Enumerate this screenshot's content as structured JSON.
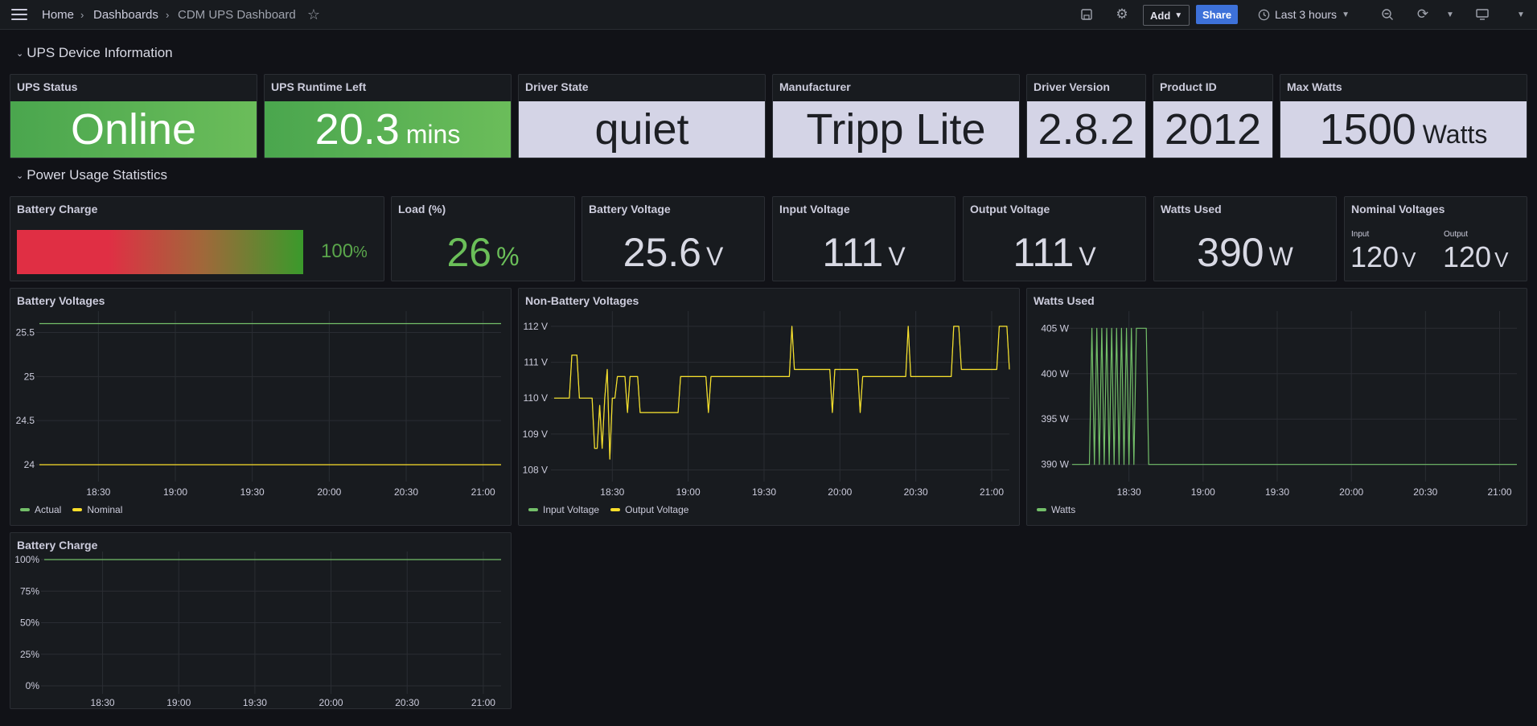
{
  "breadcrumb": {
    "home": "Home",
    "dashboards": "Dashboards",
    "current": "CDM UPS Dashboard"
  },
  "toolbar": {
    "add_label": "Add",
    "share_label": "Share",
    "time_range": "Last 3 hours"
  },
  "rows": {
    "device_info": "UPS Device Information",
    "power_usage": "Power Usage Statistics"
  },
  "device_stats": {
    "ups_status": {
      "title": "UPS Status",
      "value": "Online"
    },
    "runtime": {
      "title": "UPS Runtime Left",
      "value": "20.3",
      "unit": "mins"
    },
    "driver_state": {
      "title": "Driver State",
      "value": "quiet"
    },
    "manufacturer": {
      "title": "Manufacturer",
      "value": "Tripp Lite"
    },
    "driver_version": {
      "title": "Driver Version",
      "value": "2.8.2"
    },
    "product_id": {
      "title": "Product ID",
      "value": "2012"
    },
    "max_watts": {
      "title": "Max Watts",
      "value": "1500",
      "unit": "Watts"
    }
  },
  "power_stats": {
    "battery_charge": {
      "title": "Battery Charge",
      "value": "100",
      "unit": "%",
      "fraction": 1.0
    },
    "load": {
      "title": "Load (%)",
      "value": "26",
      "unit": "%"
    },
    "battery_voltage": {
      "title": "Battery Voltage",
      "value": "25.6",
      "unit": "V"
    },
    "input_voltage": {
      "title": "Input Voltage",
      "value": "111",
      "unit": "V"
    },
    "output_voltage": {
      "title": "Output Voltage",
      "value": "111",
      "unit": "V"
    },
    "watts_used": {
      "title": "Watts Used",
      "value": "390",
      "unit": "W"
    },
    "nominal_voltages": {
      "title": "Nominal Voltages",
      "input_label": "Input",
      "input_value": "120",
      "input_unit": "V",
      "output_label": "Output",
      "output_value": "120",
      "output_unit": "V"
    }
  },
  "colors": {
    "green": "#73bf69",
    "yellow": "#fade2a",
    "accent_blue": "#3d71d9",
    "red": "#e02f44"
  },
  "chart_data": [
    {
      "type": "line",
      "title": "Battery Voltages",
      "x_ticks": [
        "18:30",
        "19:00",
        "19:30",
        "20:00",
        "20:30",
        "21:00"
      ],
      "y_ticks": [
        "25.5",
        "25",
        "24.5",
        "24"
      ],
      "ylim": [
        23.9,
        25.65
      ],
      "series": [
        {
          "name": "Actual",
          "color": "#73bf69",
          "points": [
            [
              "18:07",
              25.6
            ],
            [
              "21:07",
              25.6
            ]
          ]
        },
        {
          "name": "Nominal",
          "color": "#fade2a",
          "points": [
            [
              "18:07",
              24
            ],
            [
              "21:07",
              24
            ]
          ]
        }
      ]
    },
    {
      "type": "line",
      "title": "Non-Battery Voltages",
      "x_ticks": [
        "18:30",
        "19:00",
        "19:30",
        "20:00",
        "20:30",
        "21:00"
      ],
      "y_ticks": [
        "112 V",
        "111 V",
        "110 V",
        "109 V",
        "108 V"
      ],
      "ylim": [
        107.9,
        112.2
      ],
      "series": [
        {
          "name": "Input Voltage",
          "color": "#73bf69",
          "points": [
            [
              "18:07",
              110
            ],
            [
              "18:13",
              110
            ],
            [
              "18:14",
              111.2
            ],
            [
              "18:16",
              111.2
            ],
            [
              "18:17",
              110
            ],
            [
              "18:22",
              110
            ],
            [
              "18:23",
              108.6
            ],
            [
              "18:24",
              108.6
            ],
            [
              "18:25",
              109.8
            ],
            [
              "18:26",
              108.6
            ],
            [
              "18:27",
              110
            ],
            [
              "18:28",
              110.8
            ],
            [
              "18:29",
              108.3
            ],
            [
              "18:30",
              110
            ],
            [
              "18:31",
              110
            ],
            [
              "18:32",
              110.6
            ],
            [
              "18:35",
              110.6
            ],
            [
              "18:36",
              109.6
            ],
            [
              "18:37",
              110.6
            ],
            [
              "18:40",
              110.6
            ],
            [
              "18:41",
              109.6
            ],
            [
              "18:56",
              109.6
            ],
            [
              "18:57",
              110.6
            ],
            [
              "19:07",
              110.6
            ],
            [
              "19:08",
              109.6
            ],
            [
              "19:09",
              110.6
            ],
            [
              "19:40",
              110.6
            ],
            [
              "19:41",
              112
            ],
            [
              "19:42",
              110.8
            ],
            [
              "19:56",
              110.8
            ],
            [
              "19:57",
              109.6
            ],
            [
              "19:58",
              110.8
            ],
            [
              "20:07",
              110.8
            ],
            [
              "20:08",
              109.6
            ],
            [
              "20:09",
              110.6
            ],
            [
              "20:26",
              110.6
            ],
            [
              "20:27",
              112
            ],
            [
              "20:28",
              110.6
            ],
            [
              "20:44",
              110.6
            ],
            [
              "20:45",
              112
            ],
            [
              "20:47",
              112
            ],
            [
              "20:48",
              110.8
            ],
            [
              "21:02",
              110.8
            ],
            [
              "21:03",
              112
            ],
            [
              "21:06",
              112
            ],
            [
              "21:07",
              110.8
            ]
          ]
        },
        {
          "name": "Output Voltage",
          "color": "#fade2a",
          "points": [
            [
              "18:07",
              110
            ],
            [
              "18:13",
              110
            ],
            [
              "18:14",
              111.2
            ],
            [
              "18:16",
              111.2
            ],
            [
              "18:17",
              110
            ],
            [
              "18:22",
              110
            ],
            [
              "18:23",
              108.6
            ],
            [
              "18:24",
              108.6
            ],
            [
              "18:25",
              109.8
            ],
            [
              "18:26",
              108.6
            ],
            [
              "18:27",
              110
            ],
            [
              "18:28",
              110.8
            ],
            [
              "18:29",
              108.3
            ],
            [
              "18:30",
              110
            ],
            [
              "18:31",
              110
            ],
            [
              "18:32",
              110.6
            ],
            [
              "18:35",
              110.6
            ],
            [
              "18:36",
              109.6
            ],
            [
              "18:37",
              110.6
            ],
            [
              "18:40",
              110.6
            ],
            [
              "18:41",
              109.6
            ],
            [
              "18:56",
              109.6
            ],
            [
              "18:57",
              110.6
            ],
            [
              "19:07",
              110.6
            ],
            [
              "19:08",
              109.6
            ],
            [
              "19:09",
              110.6
            ],
            [
              "19:40",
              110.6
            ],
            [
              "19:41",
              112
            ],
            [
              "19:42",
              110.8
            ],
            [
              "19:56",
              110.8
            ],
            [
              "19:57",
              109.6
            ],
            [
              "19:58",
              110.8
            ],
            [
              "20:07",
              110.8
            ],
            [
              "20:08",
              109.6
            ],
            [
              "20:09",
              110.6
            ],
            [
              "20:26",
              110.6
            ],
            [
              "20:27",
              112
            ],
            [
              "20:28",
              110.6
            ],
            [
              "20:44",
              110.6
            ],
            [
              "20:45",
              112
            ],
            [
              "20:47",
              112
            ],
            [
              "20:48",
              110.8
            ],
            [
              "21:02",
              110.8
            ],
            [
              "21:03",
              112
            ],
            [
              "21:06",
              112
            ],
            [
              "21:07",
              110.8
            ]
          ]
        }
      ]
    },
    {
      "type": "line",
      "title": "Watts Used",
      "x_ticks": [
        "18:30",
        "19:00",
        "19:30",
        "20:00",
        "20:30",
        "21:00"
      ],
      "y_ticks": [
        "405 W",
        "400 W",
        "395 W",
        "390 W"
      ],
      "ylim": [
        389,
        406
      ],
      "series": [
        {
          "name": "Watts",
          "color": "#73bf69",
          "points": [
            [
              "18:07",
              390
            ],
            [
              "18:14",
              390
            ],
            [
              "18:15",
              405
            ],
            [
              "18:16",
              390
            ],
            [
              "18:17",
              405
            ],
            [
              "18:18",
              390
            ],
            [
              "18:19",
              405
            ],
            [
              "18:20",
              390
            ],
            [
              "18:21",
              405
            ],
            [
              "18:22",
              390
            ],
            [
              "18:23",
              405
            ],
            [
              "18:24",
              390
            ],
            [
              "18:25",
              405
            ],
            [
              "18:26",
              390
            ],
            [
              "18:27",
              405
            ],
            [
              "18:28",
              390
            ],
            [
              "18:29",
              405
            ],
            [
              "18:30",
              390
            ],
            [
              "18:31",
              405
            ],
            [
              "18:32",
              390
            ],
            [
              "18:33",
              405
            ],
            [
              "18:37",
              405
            ],
            [
              "18:38",
              390
            ],
            [
              "21:07",
              390
            ]
          ]
        }
      ]
    },
    {
      "type": "line",
      "title": "Battery Charge",
      "x_ticks": [
        "18:30",
        "19:00",
        "19:30",
        "20:00",
        "20:30",
        "21:00"
      ],
      "y_ticks": [
        "100%",
        "75%",
        "50%",
        "25%",
        "0%"
      ],
      "ylim": [
        0,
        100
      ],
      "series": [
        {
          "name": "Battery Charge",
          "color": "#73bf69",
          "points": [
            [
              "18:07",
              100
            ],
            [
              "21:07",
              100
            ]
          ]
        }
      ]
    }
  ]
}
